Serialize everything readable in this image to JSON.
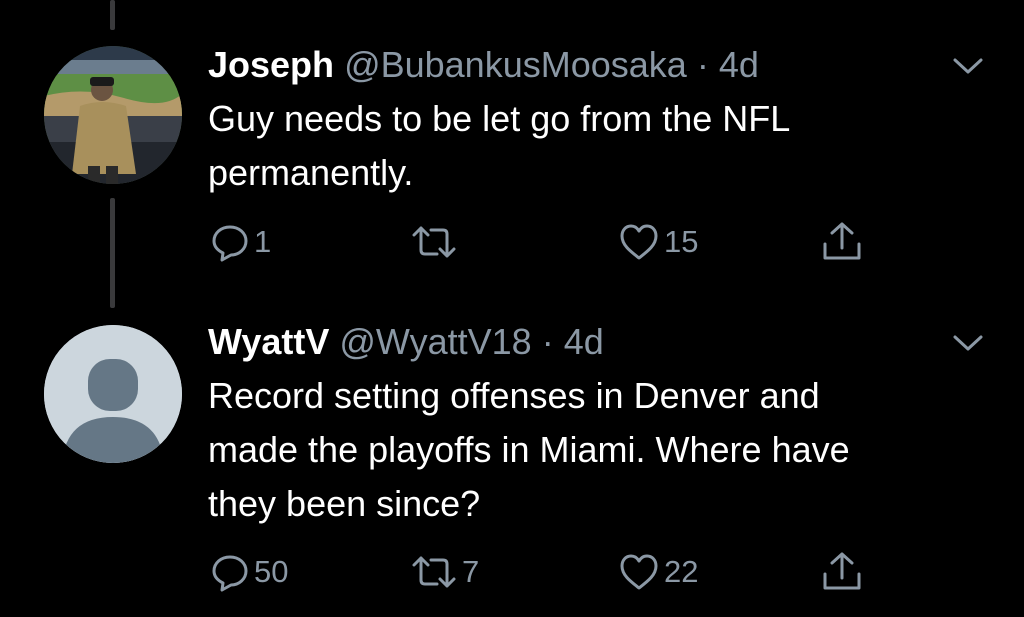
{
  "tweets": [
    {
      "name": "Joseph",
      "handle": "@BubankusMoosaka",
      "separator": "·",
      "time": "4d",
      "text_line1": "Guy needs to be let go from the NFL",
      "text_line2": "permanently.",
      "reply_count": "1",
      "retweet_count": "",
      "like_count": "15",
      "avatar": "photo-avatar"
    },
    {
      "name": "WyattV",
      "handle": "@WyattV18",
      "separator": "·",
      "time": "4d",
      "text_line1": "Record setting offenses in Denver and",
      "text_line2": "made the playoffs in Miami. Where have",
      "text_line3": "they been since?",
      "reply_count": "50",
      "retweet_count": "7",
      "like_count": "22",
      "avatar": "default-avatar"
    }
  ],
  "icons": {
    "reply": "reply-icon",
    "retweet": "retweet-icon",
    "like": "heart-icon",
    "share": "share-icon",
    "menu": "chevron-down-icon"
  },
  "colors": {
    "background": "#000000",
    "text": "#ffffff",
    "secondary": "#8b98a5",
    "thread_line": "#3a3a3c",
    "default_avatar_bg": "#ccd6dd",
    "default_avatar_fg": "#657786"
  }
}
